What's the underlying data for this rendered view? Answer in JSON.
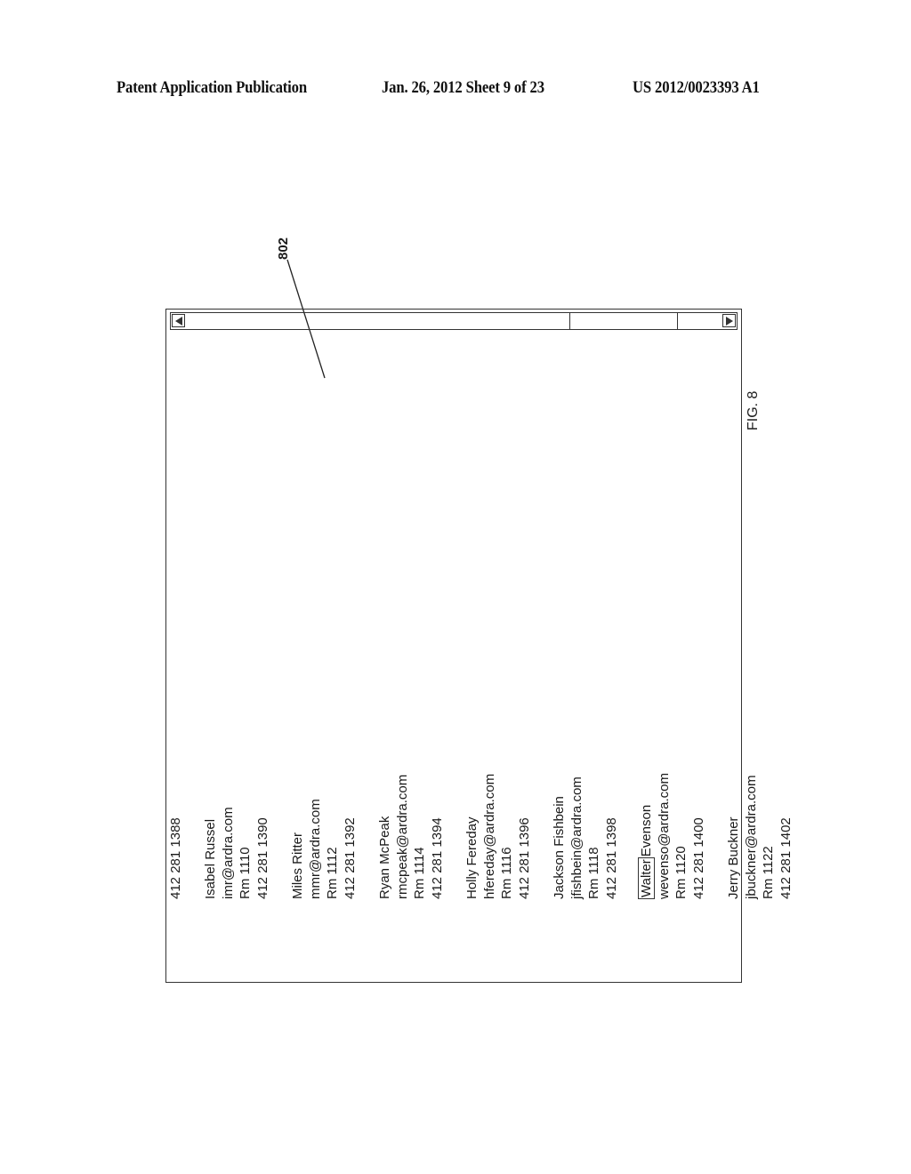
{
  "header": {
    "left": "Patent Application Publication",
    "middle": "Jan. 26, 2012   Sheet 9 of 23",
    "right": "US 2012/0023393 A1"
  },
  "figure": {
    "label": "FIG. 8",
    "reference_numeral": "802"
  },
  "window": {
    "scrollbar": {
      "left_arrow_icon": "triangle-left",
      "right_arrow_icon": "triangle-right"
    },
    "lines": [
      {
        "text": "412 281 1388"
      },
      {
        "text": ""
      },
      {
        "text": "Isabel Russel"
      },
      {
        "text": "imr@ardra.com"
      },
      {
        "text": "Rm 1110"
      },
      {
        "text": "412 281 1390"
      },
      {
        "text": ""
      },
      {
        "text": "Miles Ritter"
      },
      {
        "text": "mmr@ardra.com"
      },
      {
        "text": "Rm 1112"
      },
      {
        "text": "412 281 1392"
      },
      {
        "text": ""
      },
      {
        "text": "Ryan McPeak"
      },
      {
        "text": "rmcpeak@ardra.com"
      },
      {
        "text": "Rm 1114"
      },
      {
        "text": "412 281 1394"
      },
      {
        "text": ""
      },
      {
        "text": "Holly Fereday"
      },
      {
        "text": "hfereday@ardra.com"
      },
      {
        "text": "Rm 1116"
      },
      {
        "text": "412 281 1396"
      },
      {
        "text": ""
      },
      {
        "text": "Jackson Fishbein"
      },
      {
        "text": "jfishbein@ardra.com"
      },
      {
        "text": "Rm 1118"
      },
      {
        "text": "412 281 1398"
      },
      {
        "text": ""
      },
      {
        "text": "Evenson",
        "highlight": "Walter"
      },
      {
        "text": "wevenso@ardra.com"
      },
      {
        "text": "Rm 1120"
      },
      {
        "text": "412 281 1400"
      },
      {
        "text": ""
      },
      {
        "text": "Jerry Buckner"
      },
      {
        "text": "jbuckner@ardra.com"
      },
      {
        "text": "Rm 1122"
      },
      {
        "text": "412 281 1402"
      }
    ]
  }
}
